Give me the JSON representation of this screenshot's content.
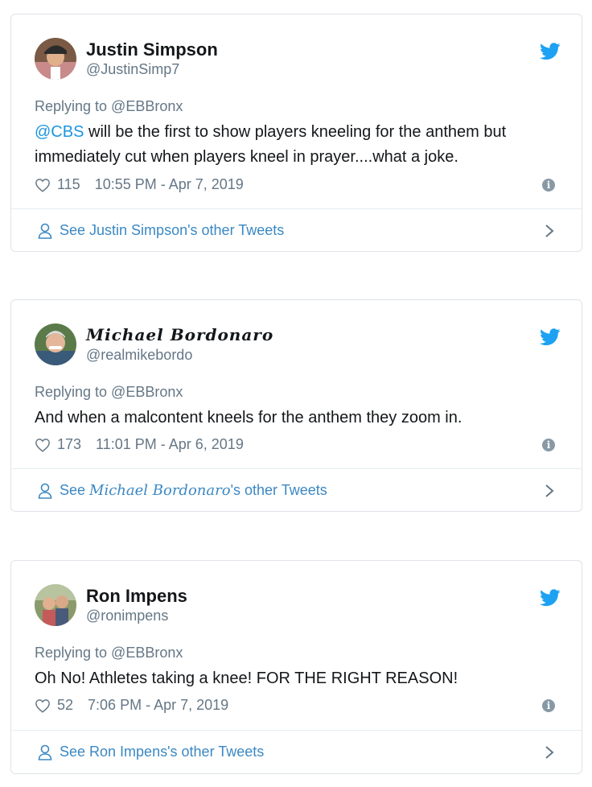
{
  "tweets": [
    {
      "name": "Justin Simpson",
      "handle": "@JustinSimp7",
      "replying": "Replying to @EBBronx",
      "mention": "@CBS",
      "text": " will be the first to show players kneeling for the anthem but immediately cut when players kneel in prayer....what a joke.",
      "likes": "115",
      "timestamp": "10:55 PM - Apr 7, 2019",
      "see_prefix": "See ",
      "see_name": "Justin Simpson",
      "see_suffix": "'s other Tweets"
    },
    {
      "name": "Michael Bordonaro",
      "handle": "@realmikebordo",
      "replying": "Replying to @EBBronx",
      "mention": "",
      "text": "And when a malcontent kneels for the anthem they zoom in.",
      "likes": "173",
      "timestamp": "11:01 PM - Apr 6, 2019",
      "see_prefix": "See ",
      "see_name": "Michael Bordonaro",
      "see_suffix": "'s other Tweets"
    },
    {
      "name": "Ron Impens",
      "handle": "@ronimpens",
      "replying": "Replying to @EBBronx",
      "mention": "",
      "text": "Oh No! Athletes taking a knee! FOR THE RIGHT REASON!",
      "likes": "52",
      "timestamp": "7:06 PM - Apr 7, 2019",
      "see_prefix": "See ",
      "see_name": "Ron Impens",
      "see_suffix": "'s other Tweets"
    }
  ],
  "colors": {
    "twitter_blue": "#1da1f2",
    "link_blue": "#1b95e0",
    "muted_gray": "#657786"
  },
  "icons": [
    "twitter-bird-icon",
    "heart-icon",
    "info-icon",
    "person-icon",
    "chevron-right-icon"
  ]
}
